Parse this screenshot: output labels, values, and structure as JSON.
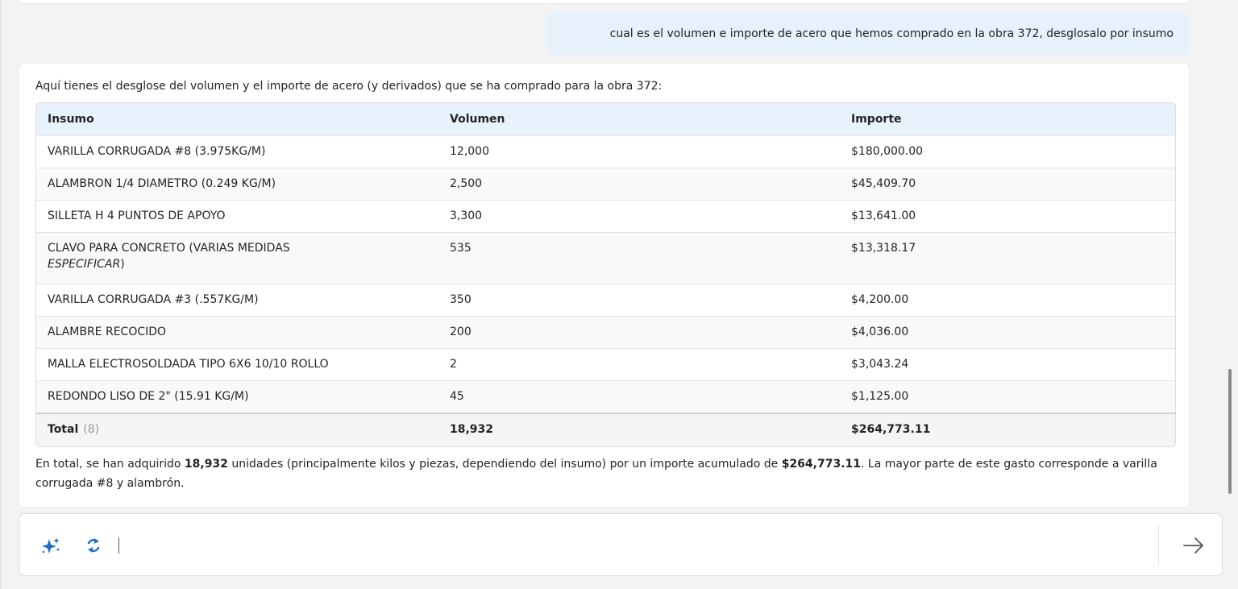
{
  "user_message": "cual es el volumen e importe de acero que hemos comprado en la obra 372, desglosalo por insumo",
  "answer": {
    "intro": "Aquí tienes el desglose del volumen y el importe de acero (y derivados) que se ha comprado para la obra 372:",
    "table": {
      "headers": [
        "Insumo",
        "Volumen",
        "Importe"
      ],
      "rows": [
        {
          "insumo": "VARILLA CORRUGADA #8 (3.975KG/M)",
          "volumen": "12,000",
          "importe": "$180,000.00"
        },
        {
          "insumo": "ALAMBRON 1/4 DIAMETRO (0.249 KG/M)",
          "volumen": "2,500",
          "importe": "$45,409.70"
        },
        {
          "insumo": "SILLETA H 4 PUNTOS DE APOYO",
          "volumen": "3,300",
          "importe": "$13,641.00"
        },
        {
          "insumo_plain": "CLAVO PARA CONCRETO (VARIAS MEDIDAS",
          "insumo_italic": "ESPECIFICAR",
          "insumo_close": ")",
          "volumen": "535",
          "importe": "$13,318.17"
        },
        {
          "insumo": "VARILLA CORRUGADA #3 (.557KG/M)",
          "volumen": "350",
          "importe": "$4,200.00"
        },
        {
          "insumo": "ALAMBRE RECOCIDO",
          "volumen": "200",
          "importe": "$4,036.00"
        },
        {
          "insumo": "MALLA ELECTROSOLDADA TIPO 6X6 10/10 ROLLO",
          "volumen": "2",
          "importe": "$3,043.24"
        },
        {
          "insumo": "REDONDO LISO DE 2\" (15.91 KG/M)",
          "volumen": "45",
          "importe": "$1,125.00"
        }
      ],
      "total": {
        "label": "Total",
        "count": "(8)",
        "volumen": "18,932",
        "importe": "$264,773.11"
      }
    },
    "summary": {
      "part1": "En total, se han adquirido ",
      "bold1": "18,932",
      "part2": " unidades (principalmente kilos y piezas, dependiendo del insumo) por un importe acumulado de ",
      "bold2": "$264,773.11",
      "part3": ". La mayor parte de este gasto corresponde a varilla corrugada #8 y alambrón."
    }
  },
  "composer": {
    "icons": {
      "left1": "sparkle-icon",
      "left2": "refresh-icon",
      "send": "arrow-right-icon"
    }
  },
  "colors": {
    "user_bubble": "#e7f1fb",
    "table_header": "#e8f2fc",
    "icon_blue": "#1f6fd1"
  }
}
